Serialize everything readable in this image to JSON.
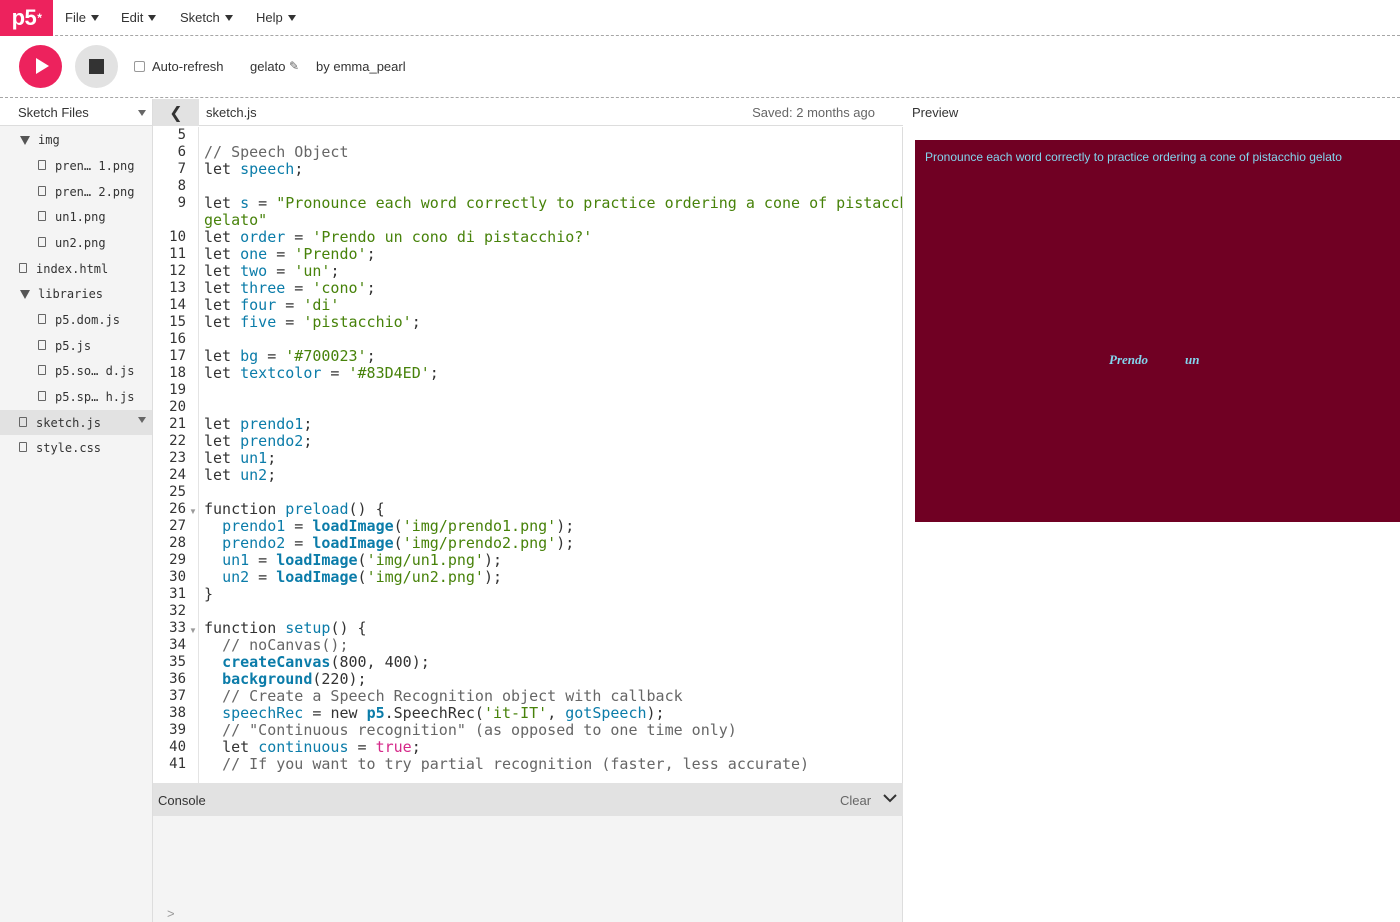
{
  "nav": {
    "logo": "p5",
    "logo_star": "*",
    "menus": [
      "File",
      "Edit",
      "Sketch",
      "Help"
    ]
  },
  "toolbar": {
    "auto_refresh_label": "Auto-refresh",
    "auto_refresh_checked": false,
    "sketch_name": "gelato",
    "author": "by emma_pearl"
  },
  "sidebar": {
    "title": "Sketch Files",
    "items": [
      {
        "label": "img",
        "type": "folder"
      },
      {
        "label": "pren… 1.png",
        "type": "file"
      },
      {
        "label": "pren… 2.png",
        "type": "file"
      },
      {
        "label": "un1.png",
        "type": "file"
      },
      {
        "label": "un2.png",
        "type": "file"
      },
      {
        "label": "index.html",
        "type": "file"
      },
      {
        "label": "libraries",
        "type": "folder"
      },
      {
        "label": "p5.dom.js",
        "type": "file"
      },
      {
        "label": "p5.js",
        "type": "file"
      },
      {
        "label": "p5.so… d.js",
        "type": "file"
      },
      {
        "label": "p5.sp… h.js",
        "type": "file"
      },
      {
        "label": "sketch.js",
        "type": "file",
        "selected": true
      },
      {
        "label": "style.css",
        "type": "file"
      }
    ]
  },
  "editor": {
    "tab_name": "sketch.js",
    "saved_status": "Saved: 2 months ago",
    "line_numbers": [
      "5",
      "6",
      "7",
      "8",
      "9",
      "",
      "10",
      "11",
      "12",
      "13",
      "14",
      "15",
      "16",
      "17",
      "18",
      "19",
      "20",
      "21",
      "22",
      "23",
      "24",
      "25",
      "26",
      "27",
      "28",
      "29",
      "30",
      "31",
      "32",
      "33",
      "34",
      "35",
      "36",
      "37",
      "38",
      "39",
      "40",
      "41"
    ]
  },
  "console": {
    "title": "Console",
    "clear_label": "Clear",
    "prompt": ">"
  },
  "preview": {
    "title": "Preview",
    "sentence": "Pronounce each word correctly to practice ordering a cone of pistacchio gelato",
    "word1": "Prendo",
    "word2": "un",
    "bg_color": "#700023",
    "text_color": "#83D4ED"
  },
  "colors": {
    "accent": "#ed225d"
  }
}
